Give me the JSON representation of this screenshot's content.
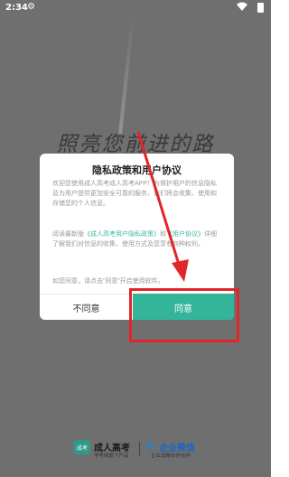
{
  "status_bar": {
    "time": "2:34"
  },
  "background": {
    "slogan": "照亮您前进的路"
  },
  "dialog": {
    "title": "隐私政策和用户协议",
    "paragraph1": "欢迎您使用成人高考成人高考APP！为保护用户的信息隐私及为用户提供更加安全可靠的服务，我们将会收集、使用和存储您的个人信息。",
    "paragraph2_prefix": "阅读最新版",
    "privacy_link": "《成人高考用户隐私政策》",
    "paragraph2_and": "和",
    "agreement_link": "《用户协议》",
    "paragraph2_suffix": "详细了解我们对信息的收集、使用方式及您享有何种权利。",
    "paragraph3": "如您同意，请点击“同意”开启使用软件。",
    "disagree_label": "不同意",
    "agree_label": "同意"
  },
  "footer": {
    "brand1_mark": "成考",
    "brand1_name": "成人高考",
    "brand1_sub": "学考网旗下产品",
    "brand2_name": "企业微信",
    "brand2_sub": "企业战略合作伙伴"
  },
  "colors": {
    "accent": "#34b59a",
    "highlight": "#e0262a",
    "overlay": "#6f6f6f"
  }
}
